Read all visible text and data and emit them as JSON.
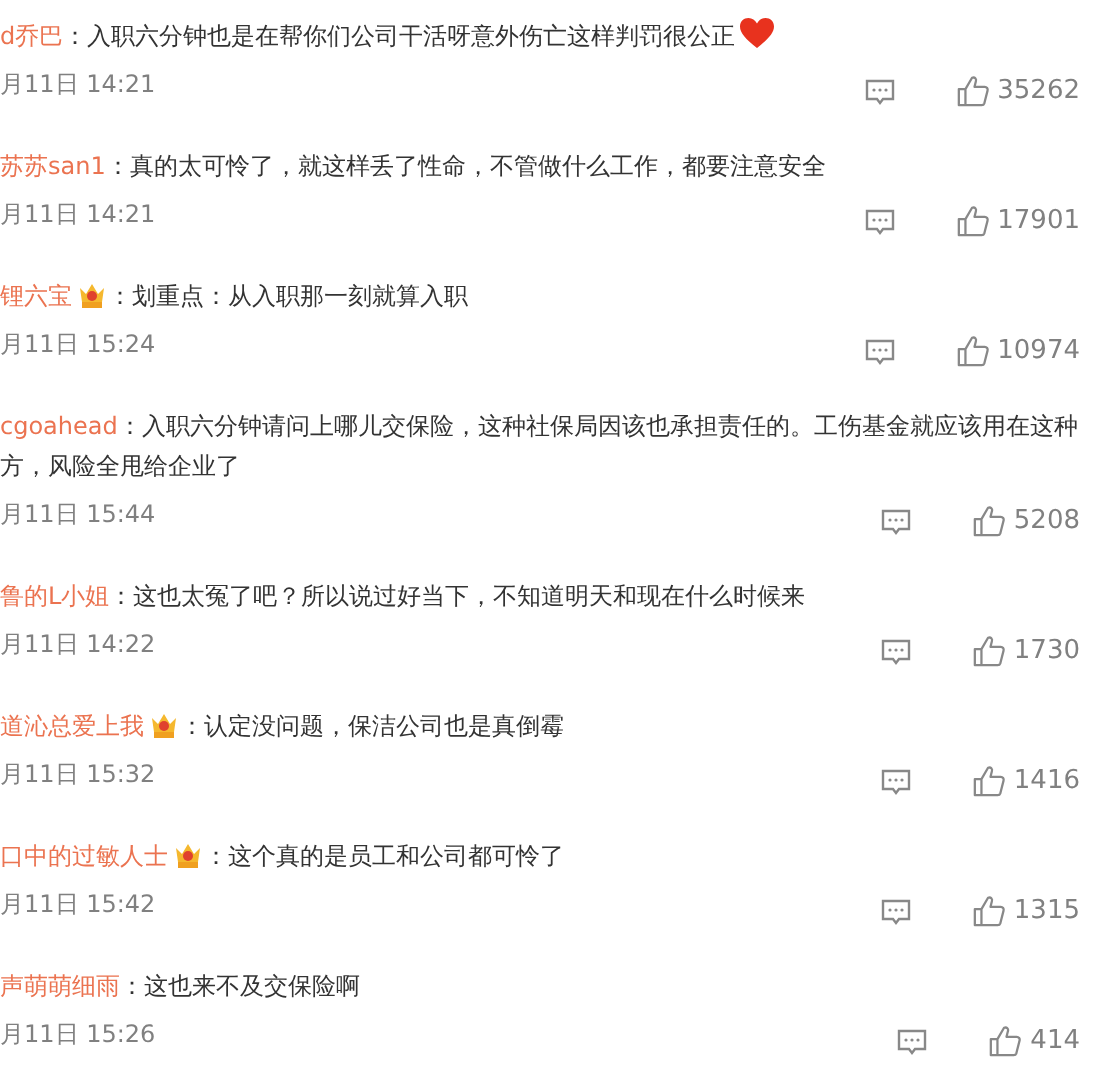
{
  "comments": [
    {
      "user": "d乔巴",
      "vip_badge": false,
      "text": "：入职六分钟也是在帮你们公司干活呀意外伤亡这样判罚很公正",
      "heart_emoji": true,
      "time": "月11日 14:21",
      "likes": "35262"
    },
    {
      "user": "苏苏san1",
      "vip_badge": false,
      "text": "：真的太可怜了，就这样丢了性命，不管做什么工作，都要注意安全",
      "heart_emoji": false,
      "time": "月11日 14:21",
      "likes": "17901"
    },
    {
      "user": "锂六宝",
      "vip_badge": true,
      "text": "：划重点：从入职那一刻就算入职",
      "heart_emoji": false,
      "time": "月11日 15:24",
      "likes": "10974"
    },
    {
      "user": "cgoahead",
      "vip_badge": false,
      "text": "：入职六分钟请问上哪儿交保险，这种社保局因该也承担责任的。工伤基金就应该用在这种方，风险全甩给企业了",
      "heart_emoji": false,
      "time": "月11日 15:44",
      "likes": "5208"
    },
    {
      "user": "鲁的L小姐",
      "vip_badge": false,
      "text": "：这也太冤了吧？所以说过好当下，不知道明天和现在什么时候来",
      "heart_emoji": false,
      "time": "月11日 14:22",
      "likes": "1730"
    },
    {
      "user": "道沁总爱上我",
      "vip_badge": true,
      "text": "：认定没问题，保洁公司也是真倒霉",
      "heart_emoji": false,
      "time": "月11日 15:32",
      "likes": "1416"
    },
    {
      "user": "口中的过敏人士",
      "vip_badge": true,
      "text": "：这个真的是员工和公司都可怜了",
      "heart_emoji": false,
      "time": "月11日 15:42",
      "likes": "1315"
    },
    {
      "user": "声萌萌细雨",
      "vip_badge": false,
      "text": "：这也来不及交保险啊",
      "heart_emoji": false,
      "time": "月11日 15:26",
      "likes": "414"
    }
  ]
}
